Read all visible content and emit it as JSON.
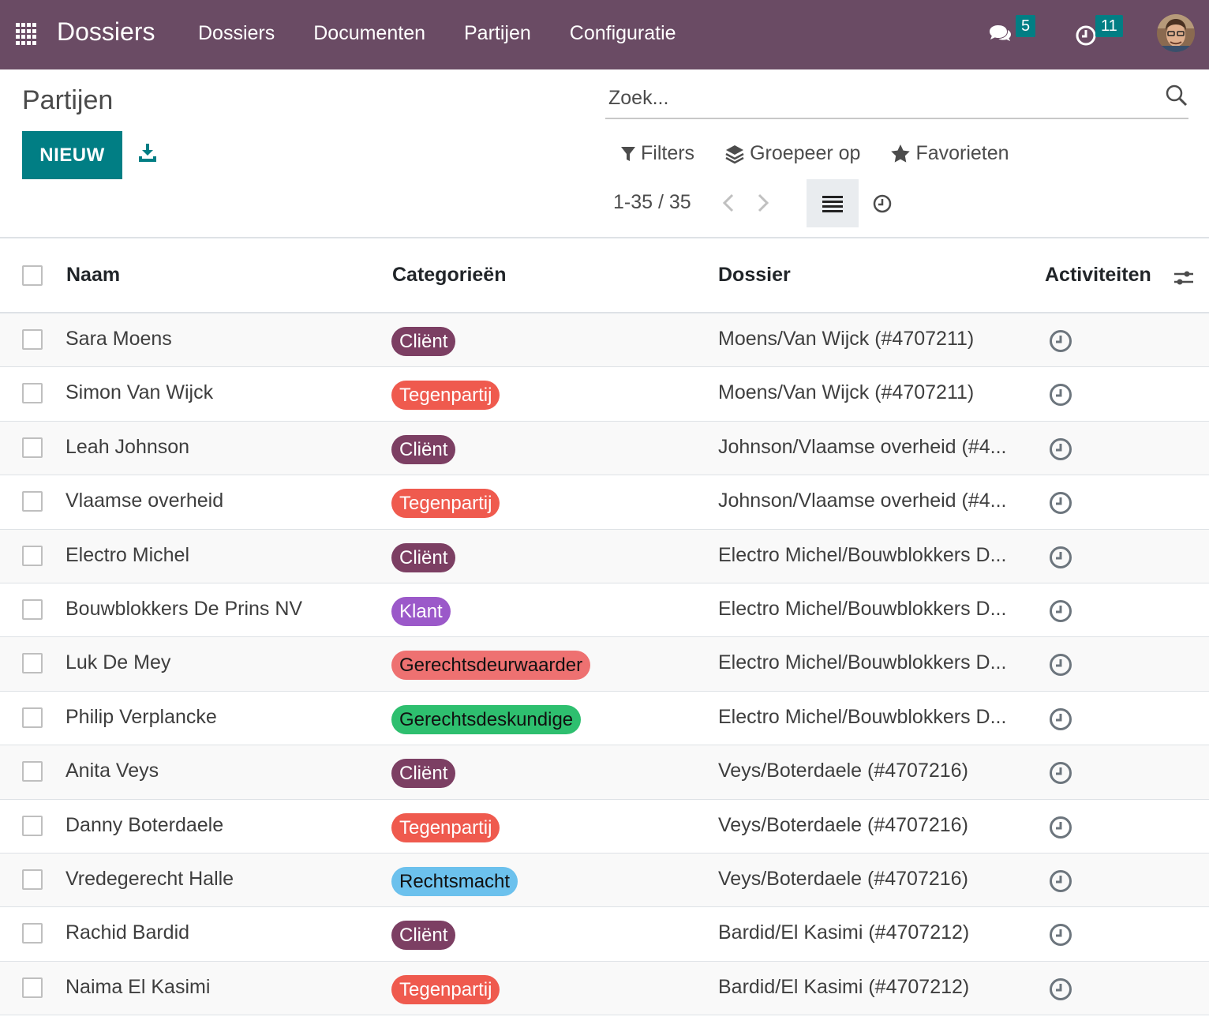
{
  "navbar": {
    "brand": "Dossiers",
    "menu": [
      "Dossiers",
      "Documenten",
      "Partijen",
      "Configuratie"
    ],
    "messages_count": "5",
    "activities_count": "11",
    "bg_color": "#6a4b64",
    "counter_color": "#017e84"
  },
  "control": {
    "title": "Partijen",
    "new_label": "NIEUW",
    "search_placeholder": "Zoek...",
    "filters_label": "Filters",
    "groupby_label": "Groepeer op",
    "favorites_label": "Favorieten",
    "pager": "1-35 / 35"
  },
  "table": {
    "headers": {
      "naam": "Naam",
      "categorieen": "Categorieën",
      "dossier": "Dossier",
      "activiteiten": "Activiteiten"
    },
    "rows": [
      {
        "naam": "Sara Moens",
        "tag": "Cliënt",
        "tag_color": "#7c3f63",
        "tag_text": "#ffffff",
        "dossier": "Moens/Van Wijck (#4707211)"
      },
      {
        "naam": "Simon Van Wijck",
        "tag": "Tegenpartij",
        "tag_color": "#ef5a4e",
        "tag_text": "#ffffff",
        "dossier": "Moens/Van Wijck (#4707211)"
      },
      {
        "naam": "Leah Johnson",
        "tag": "Cliënt",
        "tag_color": "#7c3f63",
        "tag_text": "#ffffff",
        "dossier": "Johnson/Vlaamse overheid (#4..."
      },
      {
        "naam": "Vlaamse overheid",
        "tag": "Tegenpartij",
        "tag_color": "#ef5a4e",
        "tag_text": "#ffffff",
        "dossier": "Johnson/Vlaamse overheid (#4..."
      },
      {
        "naam": "Electro Michel",
        "tag": "Cliënt",
        "tag_color": "#7c3f63",
        "tag_text": "#ffffff",
        "dossier": "Electro Michel/Bouwblokkers D..."
      },
      {
        "naam": "Bouwblokkers De Prins NV",
        "tag": "Klant",
        "tag_color": "#9b59c9",
        "tag_text": "#ffffff",
        "dossier": "Electro Michel/Bouwblokkers D..."
      },
      {
        "naam": "Luk De Mey",
        "tag": "Gerechtsdeurwaarder",
        "tag_color": "#ee7171",
        "tag_text": "#111111",
        "dossier": "Electro Michel/Bouwblokkers D..."
      },
      {
        "naam": "Philip Verplancke",
        "tag": "Gerechtsdeskundige",
        "tag_color": "#2ebf6f",
        "tag_text": "#111111",
        "dossier": "Electro Michel/Bouwblokkers D..."
      },
      {
        "naam": "Anita Veys",
        "tag": "Cliënt",
        "tag_color": "#7c3f63",
        "tag_text": "#ffffff",
        "dossier": "Veys/Boterdaele (#4707216)"
      },
      {
        "naam": "Danny Boterdaele",
        "tag": "Tegenpartij",
        "tag_color": "#ef5a4e",
        "tag_text": "#ffffff",
        "dossier": "Veys/Boterdaele (#4707216)"
      },
      {
        "naam": "Vredegerecht Halle",
        "tag": "Rechtsmacht",
        "tag_color": "#6cc1ed",
        "tag_text": "#111111",
        "dossier": "Veys/Boterdaele (#4707216)"
      },
      {
        "naam": "Rachid Bardid",
        "tag": "Cliënt",
        "tag_color": "#7c3f63",
        "tag_text": "#ffffff",
        "dossier": "Bardid/El Kasimi (#4707212)"
      },
      {
        "naam": "Naima El Kasimi",
        "tag": "Tegenpartij",
        "tag_color": "#ef5a4e",
        "tag_text": "#ffffff",
        "dossier": "Bardid/El Kasimi (#4707212)"
      }
    ]
  }
}
